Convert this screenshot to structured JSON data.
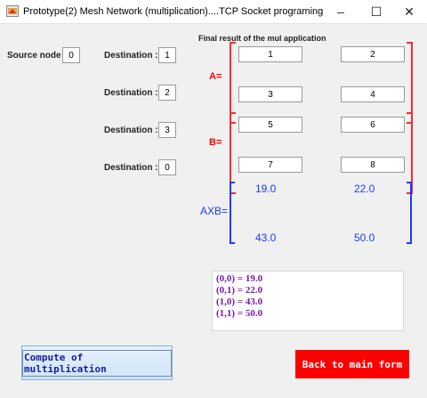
{
  "window": {
    "title": "Prototype(2) Mesh Network  (multiplication)....TCP Socket programing",
    "minimize": "–",
    "maximize": "☐",
    "close": "✕"
  },
  "source": {
    "label": "Source node :",
    "value": "0"
  },
  "destinations": [
    {
      "label": "Destination :",
      "value": "1"
    },
    {
      "label": "Destination :",
      "value": "2"
    },
    {
      "label": "Destination :",
      "value": "3"
    },
    {
      "label": "Destination :",
      "value": "0"
    }
  ],
  "matrix_header": "Final result of the mul application",
  "matrix_a": {
    "label": "A=",
    "cells": [
      "1",
      "2",
      "3",
      "4"
    ]
  },
  "matrix_b": {
    "label": "B=",
    "cells": [
      "5",
      "6",
      "7",
      "8"
    ]
  },
  "matrix_axb": {
    "label": "AXB=",
    "cells": [
      "19.0",
      "22.0",
      "43.0",
      "50.0"
    ]
  },
  "results": [
    "(0,0) = 19.0",
    "(0,1) = 22.0",
    "(1,0) = 43.0",
    "(1,1) = 50.0"
  ],
  "buttons": {
    "compute": "Compute of multiplication",
    "back": "Back to main form"
  },
  "colors": {
    "matrix_ab": "#ff0000",
    "matrix_axb": "#1a3cff",
    "results_text": "#7a1aa8",
    "back_button": "#ff0000"
  }
}
